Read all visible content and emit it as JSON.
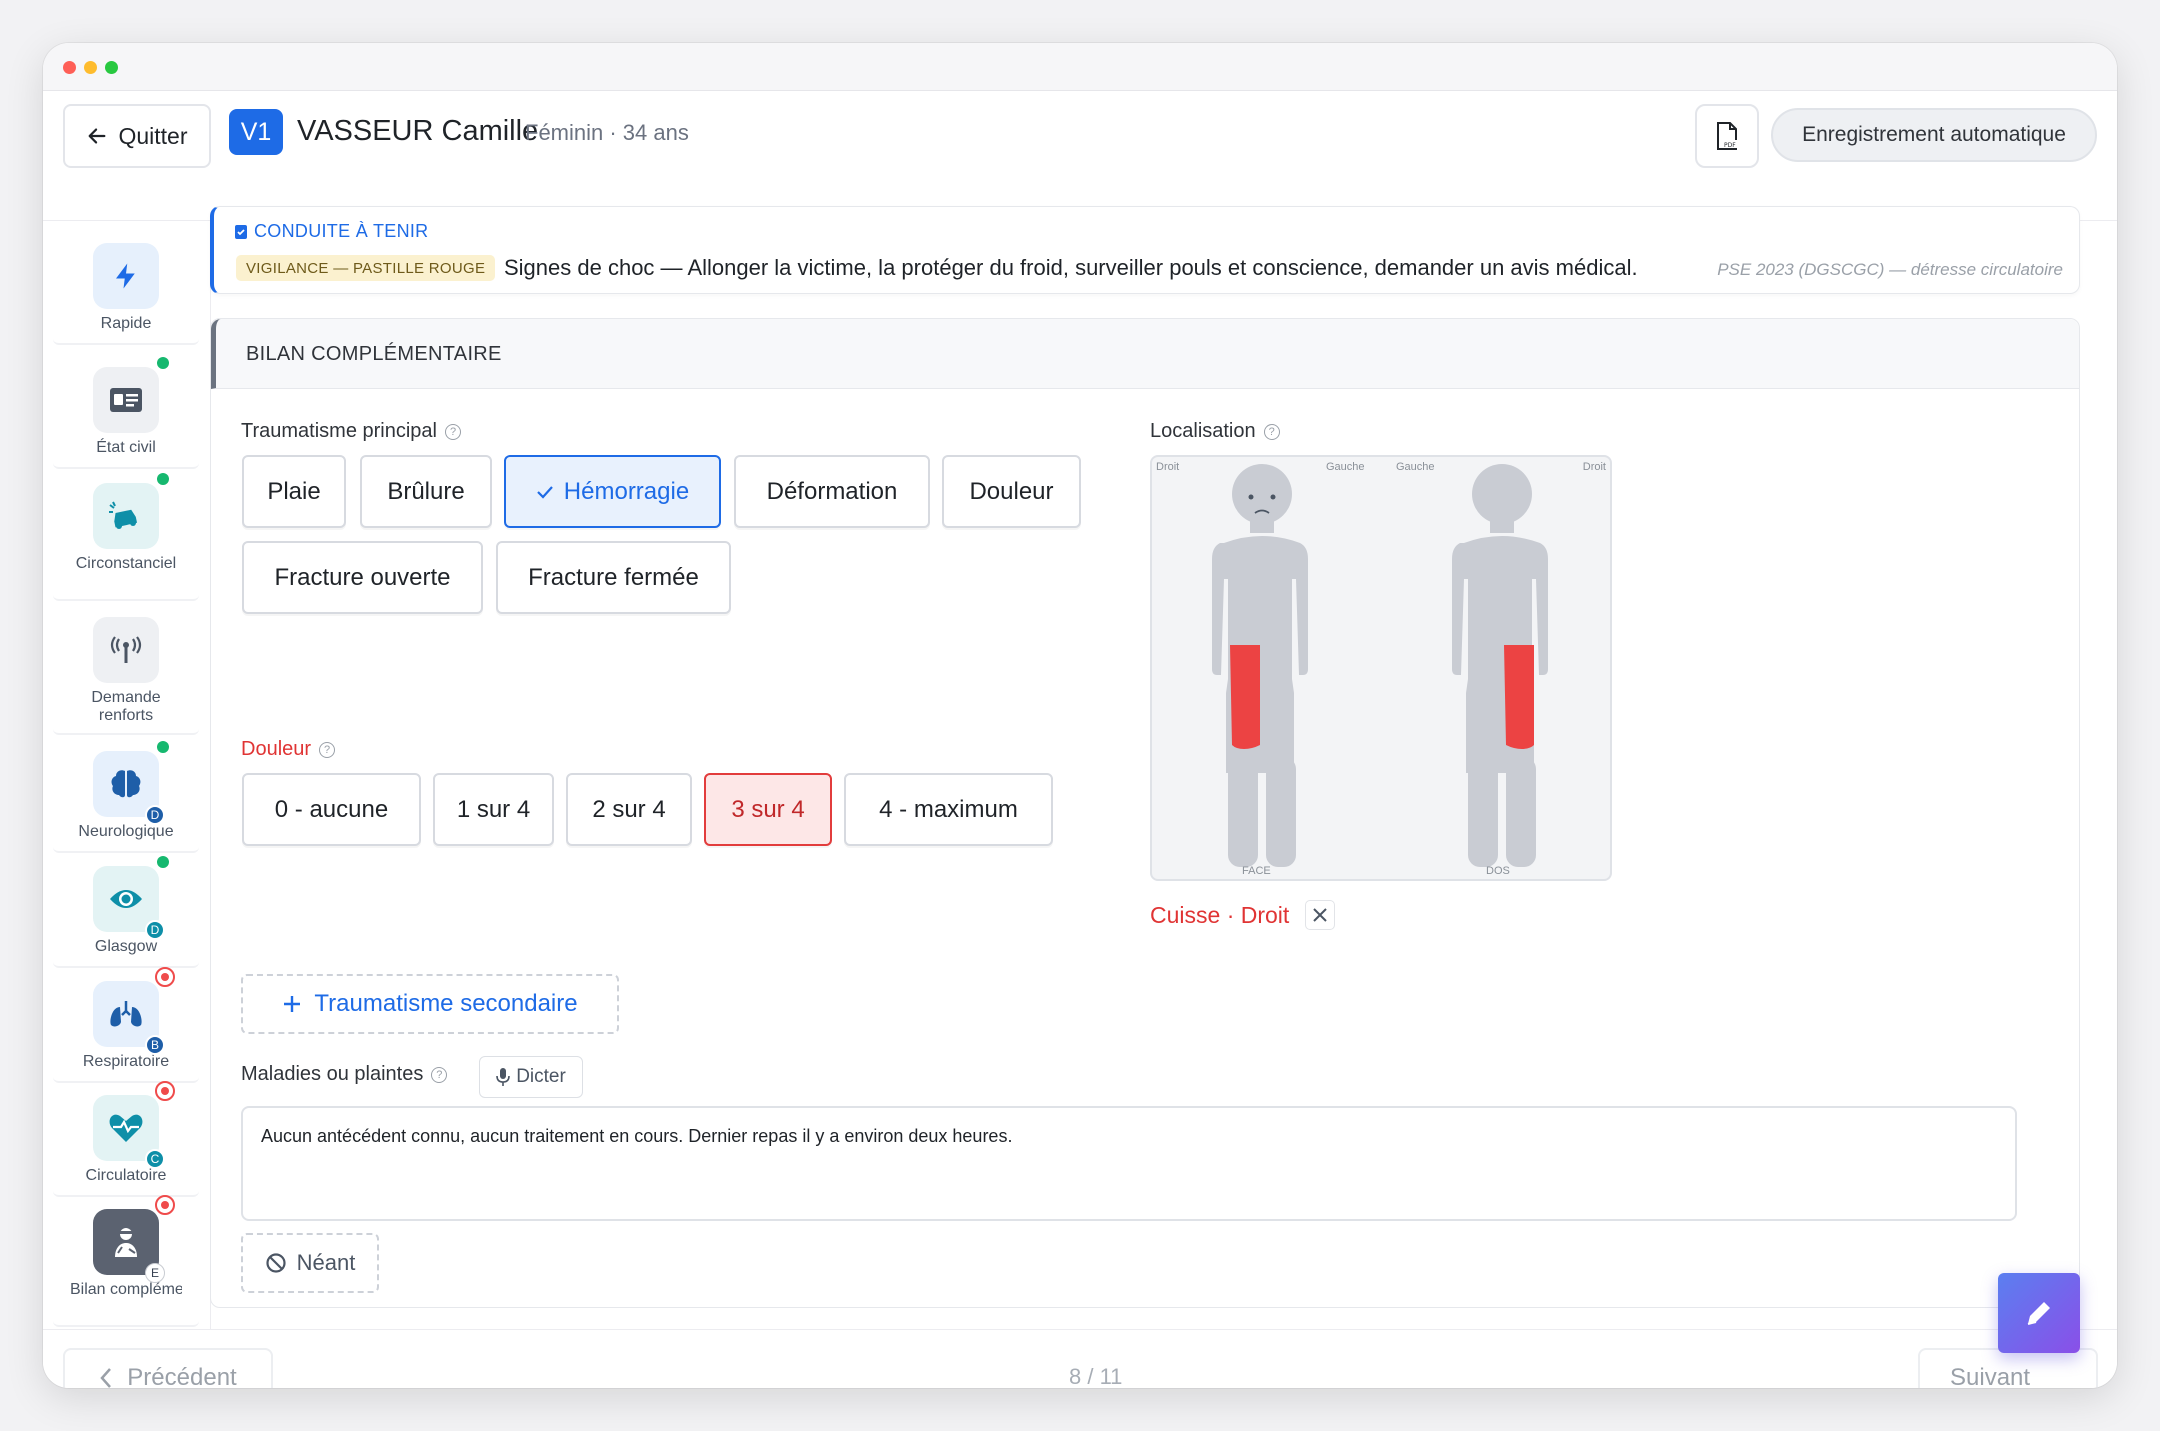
{
  "header": {
    "quit_label": "Quitter",
    "victim_code": "V1",
    "patient_name": "VASSEUR Camille",
    "patient_meta": "Féminin · 34 ans",
    "pdf_icon": "pdf-file-icon",
    "autosave_label": "Enregistrement automatique"
  },
  "sidebar": {
    "items": [
      {
        "label": "Rapide",
        "icon": "lightning-icon"
      },
      {
        "label": "État civil",
        "icon": "id-card-icon"
      },
      {
        "label": "Circonstanciel",
        "icon": "car-crash-icon"
      },
      {
        "label": "Demande renforts",
        "icon": "antenna-icon"
      },
      {
        "label": "Neurologique",
        "icon": "brain-icon",
        "badge": "D"
      },
      {
        "label": "Glasgow",
        "icon": "eye-icon",
        "badge": "D"
      },
      {
        "label": "Respiratoire",
        "icon": "lungs-icon",
        "badge": "B"
      },
      {
        "label": "Circulatoire",
        "icon": "heart-pulse-icon",
        "badge": "C"
      },
      {
        "label": "Bilan complémen…",
        "icon": "injured-person-icon",
        "badge": "E"
      }
    ]
  },
  "alert": {
    "title": "CONDUITE À TENIR",
    "tag": "VIGILANCE — PASTILLE ROUGE",
    "text": "Signes de choc — Allonger la victime, la protéger du froid, surveiller pouls et conscience, demander un avis médical.",
    "source": "PSE 2023 (DGSCGC) — détresse circulatoire"
  },
  "section": {
    "title": "BILAN COMPLÉMENTAIRE",
    "trauma_label": "Traumatisme principal",
    "trauma_options": [
      "Plaie",
      "Brûlure",
      "Hémorragie",
      "Déformation",
      "Douleur",
      "Fracture ouverte",
      "Fracture fermée"
    ],
    "trauma_selected": "Hémorragie",
    "pain_label": "Douleur",
    "pain_options": [
      "0 - aucune",
      "1 sur 4",
      "2 sur 4",
      "3 sur 4",
      "4 - maximum"
    ],
    "pain_selected": "3 sur 4",
    "localisation_label": "Localisation",
    "body_face": {
      "left": "Droit",
      "right": "Gauche",
      "caption": "FACE"
    },
    "body_back": {
      "left": "Gauche",
      "right": "Droit",
      "caption": "DOS"
    },
    "location_selected": "Cuisse · Droit",
    "add_secondary": "Traumatisme secondaire",
    "complaints_label": "Maladies ou plaintes",
    "dictate_label": "Dicter",
    "complaints_text": "Aucun antécédent connu, aucun traitement en cours. Dernier repas il y a environ deux heures.",
    "none_label": "Néant"
  },
  "footer": {
    "prev_label": "Précédent",
    "pager": "8 / 11",
    "next_label": "Suivant"
  },
  "colors": {
    "accent": "#1e6be6",
    "danger": "#e23c3c",
    "status_ok": "#16b86f"
  }
}
